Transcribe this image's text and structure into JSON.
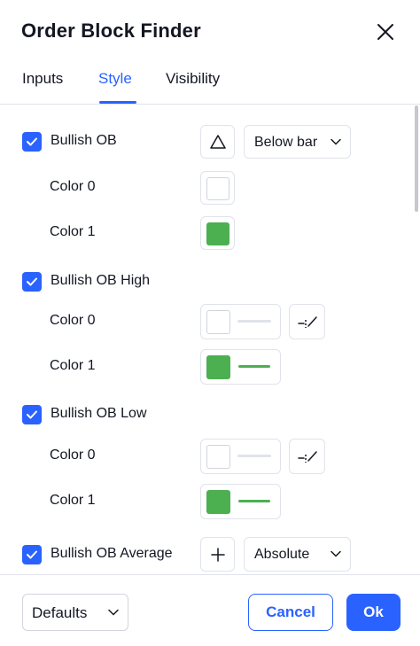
{
  "dialog": {
    "title": "Order Block Finder",
    "close_icon": "close-icon"
  },
  "tabs": [
    {
      "label": "Inputs",
      "active": false
    },
    {
      "label": "Style",
      "active": true
    },
    {
      "label": "Visibility",
      "active": false
    }
  ],
  "style": {
    "bullish_ob": {
      "label": "Bullish OB",
      "checked": true,
      "shape_icon": "triangle-up-icon",
      "location": "Below bar",
      "color0_label": "Color 0",
      "color0": "#ffffff",
      "color1_label": "Color 1",
      "color1": "#4caf50"
    },
    "bullish_ob_high": {
      "label": "Bullish OB High",
      "checked": true,
      "color0_label": "Color 0",
      "color0": "#ffffff",
      "line_style_icon": "line-style-icon",
      "color1_label": "Color 1",
      "color1": "#4caf50"
    },
    "bullish_ob_low": {
      "label": "Bullish OB Low",
      "checked": true,
      "color0_label": "Color 0",
      "color0": "#ffffff",
      "line_style_icon": "line-style-icon",
      "color1_label": "Color 1",
      "color1": "#4caf50"
    },
    "bullish_ob_average": {
      "label": "Bullish OB Average",
      "checked": true,
      "shape_icon": "plus-icon",
      "location": "Absolute"
    }
  },
  "footer": {
    "defaults_label": "Defaults",
    "cancel_label": "Cancel",
    "ok_label": "Ok"
  },
  "colors": {
    "accent": "#2962ff",
    "green": "#4caf50",
    "border": "#e0e3eb"
  }
}
